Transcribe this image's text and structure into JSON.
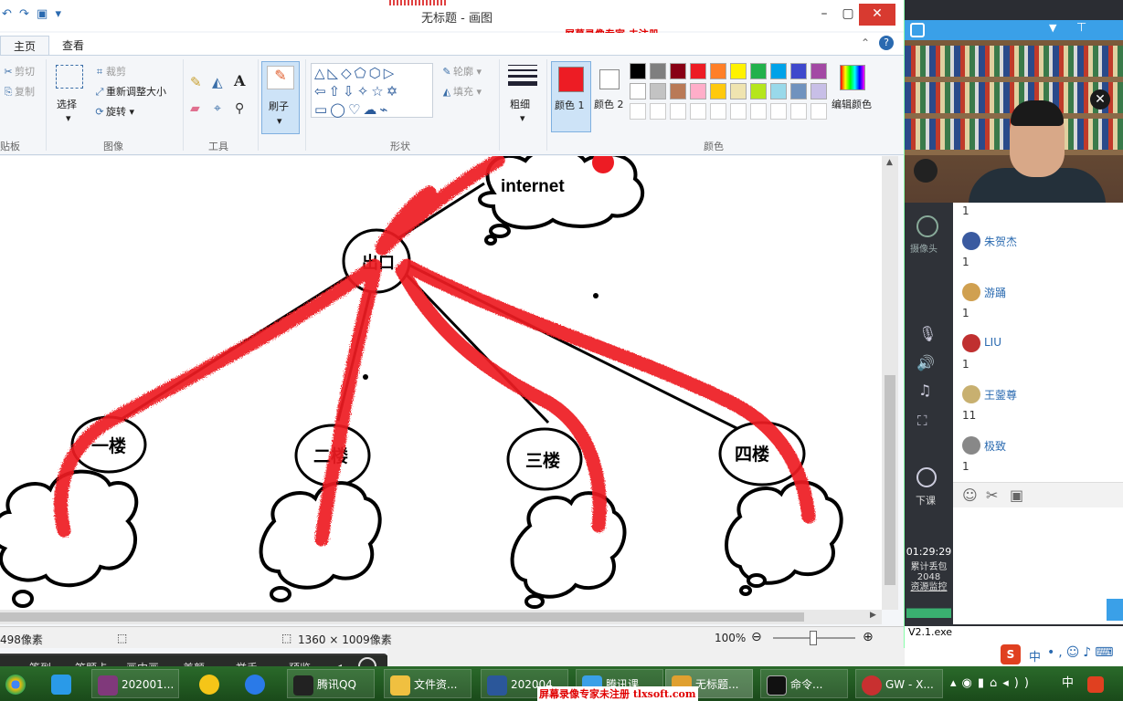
{
  "paint": {
    "title": "无标题 - 画图",
    "watermark_top": "屏幕录像专家 未注册",
    "tabs": [
      "主页",
      "查看"
    ],
    "clipboard": {
      "cut": "剪切",
      "copy": "复制",
      "label": "贴板"
    },
    "image": {
      "select": "选择",
      "crop": "裁剪",
      "resize": "重新调整大小",
      "rotate": "旋转",
      "label": "图像"
    },
    "tools": {
      "label": "工具",
      "brush": "刷子"
    },
    "shapes": {
      "outline": "轮廓",
      "fill": "填充",
      "label": "形状"
    },
    "size_label": "粗细",
    "colors": {
      "color1": "颜色 1",
      "color2": "颜色 2",
      "edit": "编辑颜色",
      "label": "颜色",
      "row1": [
        "#000000",
        "#7f7f7f",
        "#880015",
        "#ed1c24",
        "#ff7f27",
        "#fff200",
        "#22b14c",
        "#00a2e8",
        "#3f48cc",
        "#a349a4"
      ],
      "row2": [
        "#ffffff",
        "#c3c3c3",
        "#b97a57",
        "#ffaec9",
        "#ffc90e",
        "#efe4b0",
        "#b5e61d",
        "#99d9ea",
        "#7092be",
        "#c8bfe7"
      ],
      "primary": "#ed1c24",
      "secondary": "#ffffff"
    },
    "canvas": {
      "internet": "internet",
      "router": "出口",
      "floors": [
        "一楼",
        "二楼",
        "三楼",
        "四楼"
      ]
    },
    "status": {
      "position": "498像素",
      "size": "1360 × 1009像素",
      "zoom": "100%"
    }
  },
  "qq": {
    "chat": [
      {
        "msg": "1"
      },
      {
        "user": "朱贺杰",
        "msg": "1",
        "color": "#3a5aa0"
      },
      {
        "user": "游踊",
        "msg": "1",
        "color": "#d0a050"
      },
      {
        "user": "LIU",
        "msg": "1",
        "color": "#c03030"
      },
      {
        "user": "王蓥尊",
        "msg": "11",
        "color": "#c8b070"
      },
      {
        "user": "极致",
        "msg": "1",
        "color": "#888888"
      }
    ],
    "side": {
      "camera": "摄像头",
      "end_class": "下课",
      "clock": "01:29:29",
      "stats1": "累计丢包",
      "stats2": "2048",
      "stats3": "资源监控"
    },
    "exe": "V2.1.exe"
  },
  "classbar": [
    "签到",
    "答题卡",
    "画中画",
    "美颜",
    "举手",
    "预览"
  ],
  "taskbar": {
    "items": [
      "202001...",
      "腾讯QQ",
      "文件资...",
      "202004",
      "腾讯课...",
      "无标题...",
      "命令...",
      "GW - X..."
    ],
    "watermark": "屏幕录像专家未注册 tlxsoft.com",
    "tray_lang": "中"
  }
}
